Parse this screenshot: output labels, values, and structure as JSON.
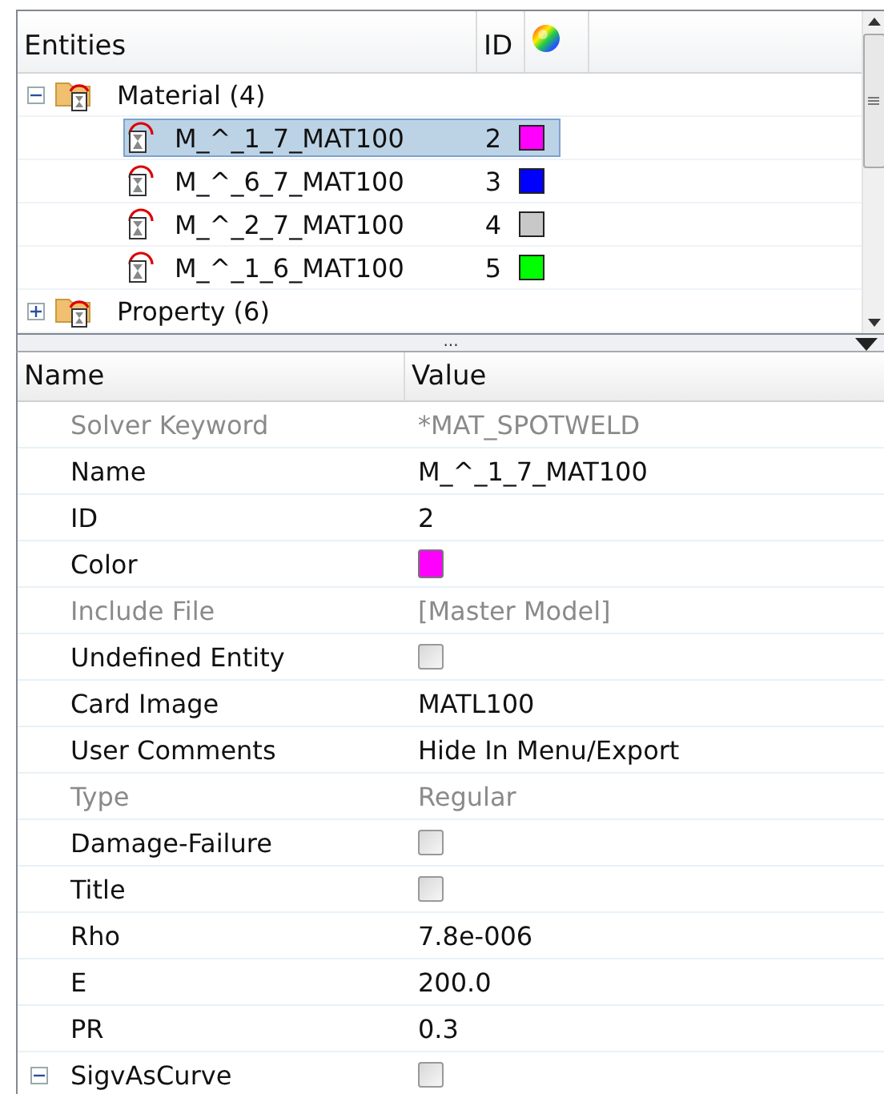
{
  "entities_panel": {
    "columns": {
      "name": "Entities",
      "id": "ID"
    },
    "tree": [
      {
        "label": "Material (4)",
        "expanded": true,
        "children": [
          {
            "label": "M_^_1_7_MAT100",
            "id": "2",
            "color": "#ff00ff",
            "selected": true
          },
          {
            "label": "M_^_6_7_MAT100",
            "id": "3",
            "color": "#0000ff",
            "selected": false
          },
          {
            "label": "M_^_2_7_MAT100",
            "id": "4",
            "color": "#c8c8c8",
            "selected": false
          },
          {
            "label": "M_^_1_6_MAT100",
            "id": "5",
            "color": "#00ff00",
            "selected": false
          }
        ]
      },
      {
        "label": "Property (6)",
        "expanded": false
      }
    ],
    "splitter": "..."
  },
  "properties_panel": {
    "columns": {
      "name": "Name",
      "value": "Value"
    },
    "rows": [
      {
        "name": "Solver Keyword",
        "kind": "text",
        "value": "*MAT_SPOTWELD",
        "disabled": true
      },
      {
        "name": "Name",
        "kind": "text",
        "value": "M_^_1_7_MAT100",
        "disabled": false
      },
      {
        "name": "ID",
        "kind": "text",
        "value": "2",
        "disabled": false
      },
      {
        "name": "Color",
        "kind": "color",
        "color": "#ff00ff",
        "disabled": false
      },
      {
        "name": "Include File",
        "kind": "text",
        "value": "[Master Model]",
        "disabled": true
      },
      {
        "name": "Undefined Entity",
        "kind": "checkbox",
        "checked": false,
        "disabled": false
      },
      {
        "name": "Card Image",
        "kind": "text",
        "value": "MATL100",
        "disabled": false
      },
      {
        "name": "User Comments",
        "kind": "text",
        "value": "Hide In Menu/Export",
        "disabled": false
      },
      {
        "name": "Type",
        "kind": "text",
        "value": "Regular",
        "disabled": true
      },
      {
        "name": "Damage-Failure",
        "kind": "checkbox",
        "checked": false,
        "disabled": false
      },
      {
        "name": "Title",
        "kind": "checkbox",
        "checked": false,
        "disabled": false
      },
      {
        "name": "Rho",
        "kind": "text",
        "value": "7.8e-006",
        "disabled": false
      },
      {
        "name": "E",
        "kind": "text",
        "value": "200.0",
        "disabled": false
      },
      {
        "name": "PR",
        "kind": "text",
        "value": "0.3",
        "disabled": false
      },
      {
        "name": "SigvAsCurve",
        "kind": "checkbox",
        "checked": false,
        "disabled": false,
        "expanded": true
      }
    ]
  }
}
